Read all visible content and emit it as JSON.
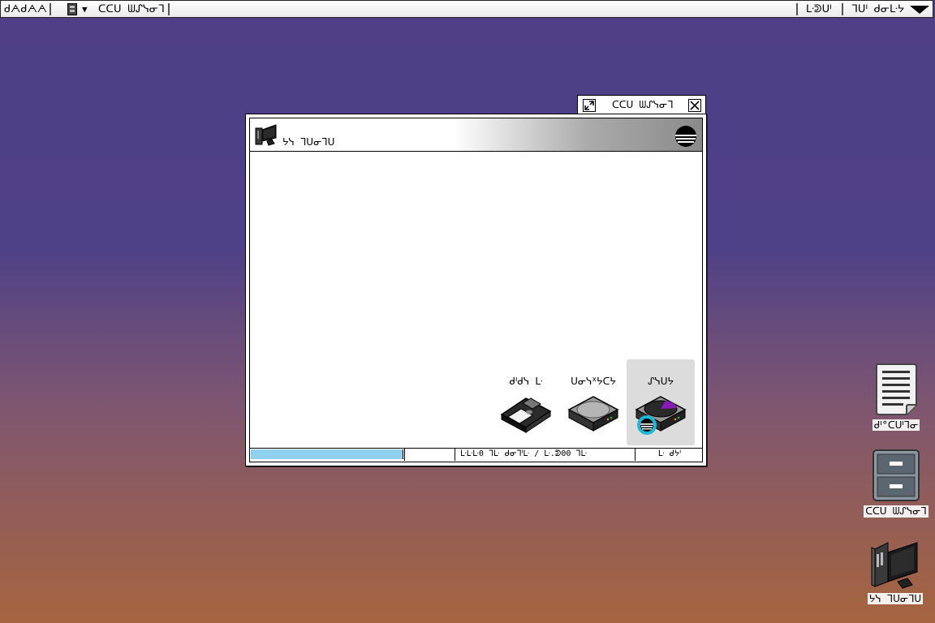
{
  "menubar": {
    "brand": "ᑯᗅᑯᗅᗅ",
    "app_name": "ᑕᑕᑌ ᗯᔑᓭᓂᒣ",
    "clock": "ᒷᕲᑌᑊ",
    "user": "ᒣᑌᑊ ᑯᓂᒷᔭ"
  },
  "window": {
    "tab_title": "ᑕᑕᑌ ᗯᔑᓭᓂᒣ",
    "title": "ᔭᓭ ᒣᑌᓂᒣᑌ",
    "drives": [
      {
        "label": "ᑯᑊᑯᓭ ᒷ",
        "kind": "floppy-disk"
      },
      {
        "label": "ᑌᓂᓭᕽᔭᑕᔭ",
        "kind": "hard-drive"
      },
      {
        "label": "ᔑᓭᑌᔭ",
        "kind": "system-drive",
        "selected": true
      }
    ],
    "status": {
      "progress_fraction": 0.335,
      "cell2": "",
      "space": "ᒷᒷᒷ0 ᒣᒷ ᑯᓂᒣᑊᒷ / ᒷ.ᕲ00 ᒣᒷ",
      "count": "ᒷ ᑯᔭᑊ"
    }
  },
  "desktop": {
    "icons": [
      {
        "label": "ᑯᑊ°ᑕᑌᑊᒣᓂ"
      },
      {
        "label": "ᑕᑕᑌ ᗯᔑᓭᓂᒣ"
      },
      {
        "label": "ᔭᓭ ᒣᑌᓂᒣᑌ"
      }
    ]
  },
  "colors": {
    "desktop_top": "#4e3f87",
    "desktop_bottom": "#a7653f",
    "progress": "#8fd0f0",
    "selection": "#dcdcdc",
    "badge": "#1fb5d6",
    "accent_purple": "#8a1ab8"
  }
}
